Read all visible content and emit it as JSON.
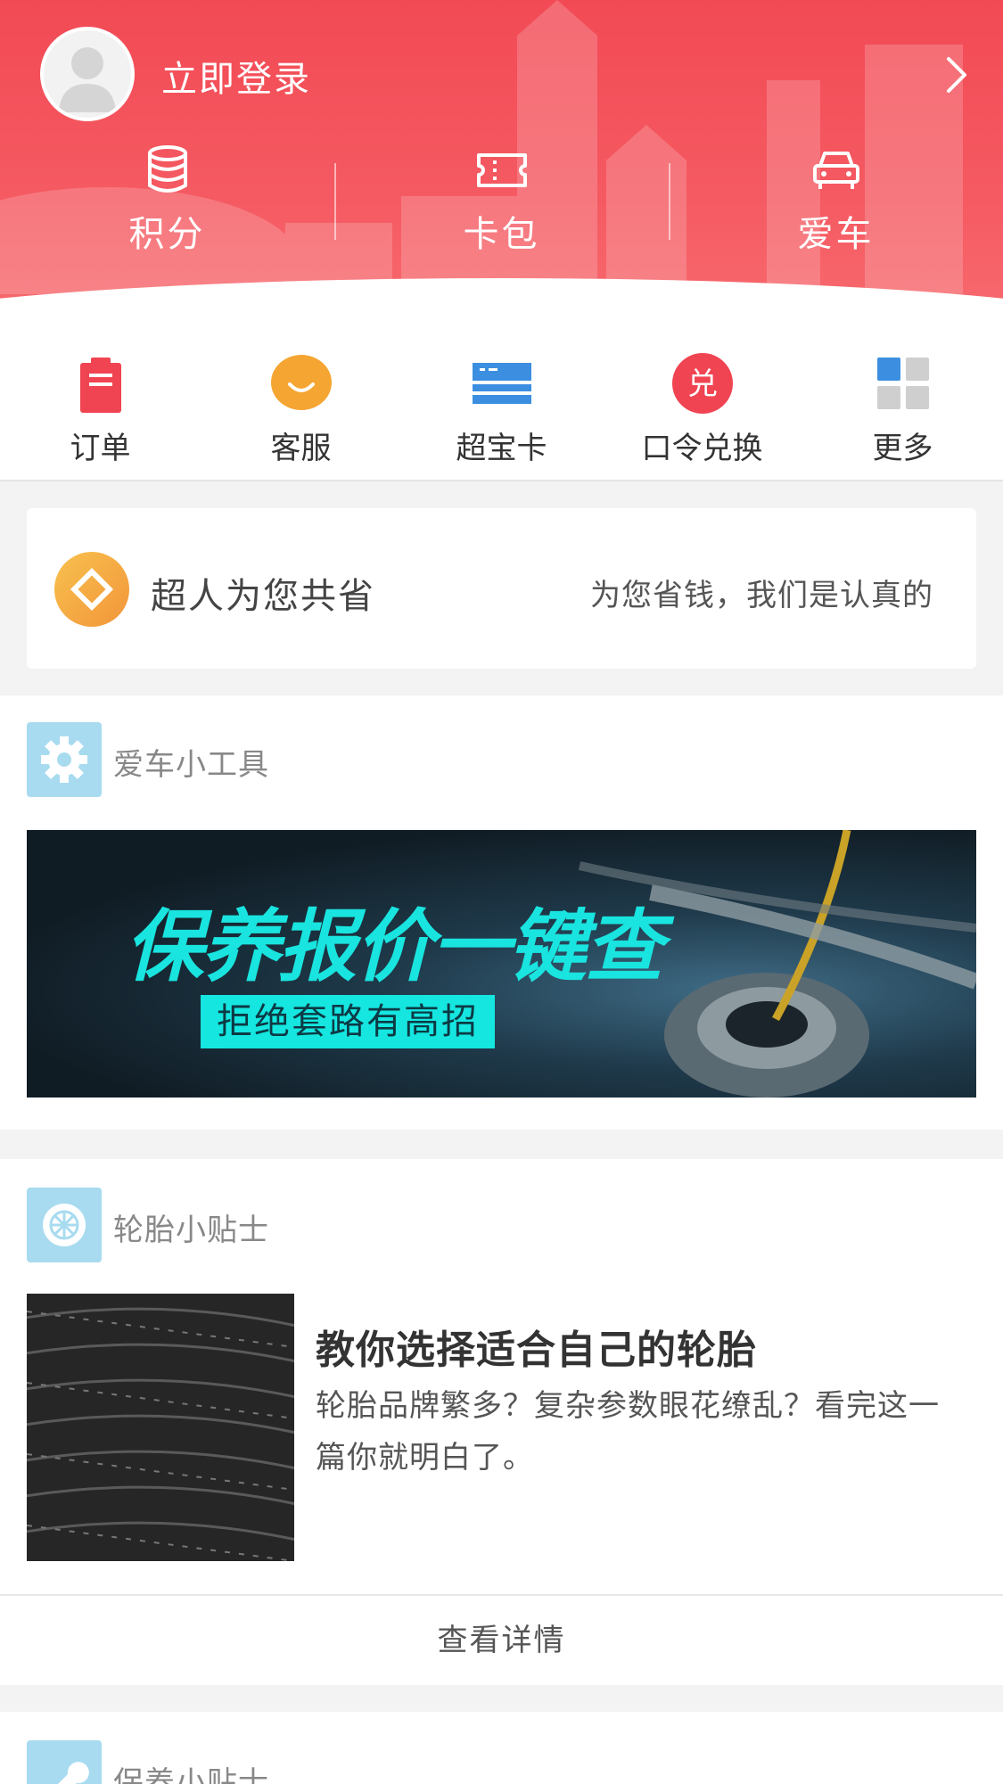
{
  "header": {
    "login_label": "立即登录",
    "stats": [
      {
        "label": "积分",
        "icon": "database-icon"
      },
      {
        "label": "卡包",
        "icon": "ticket-icon"
      },
      {
        "label": "爱车",
        "icon": "car-icon"
      }
    ],
    "brand_color": "#f24a55"
  },
  "quicknav": [
    {
      "label": "订单",
      "icon": "clipboard-icon",
      "color": "#f04452"
    },
    {
      "label": "客服",
      "icon": "smile-chat-icon",
      "color": "#f5a532"
    },
    {
      "label": "超宝卡",
      "icon": "card-icon",
      "color": "#3c8fe0"
    },
    {
      "label": "口令兑换",
      "icon": "redeem-icon",
      "badge": "兑",
      "color": "#f04452"
    },
    {
      "label": "更多",
      "icon": "grid-icon",
      "color": "#3c8fe0"
    }
  ],
  "save_card": {
    "title": "超人为您共省",
    "subtitle": "为您省钱，我们是认真的",
    "accent": "#f5a532"
  },
  "tools_section": {
    "title": "爱车小工具",
    "banner": {
      "headline": "保养报价一键查",
      "tagline": "拒绝套路有高招"
    }
  },
  "tire_section": {
    "title": "轮胎小贴士",
    "article": {
      "title": "教你选择适合自己的轮胎",
      "description": "轮胎品牌繁多？复杂参数眼花缭乱？看完这一篇你就明白了。"
    },
    "detail_label": "查看详情"
  },
  "maintenance_section": {
    "title": "保养小贴士"
  }
}
